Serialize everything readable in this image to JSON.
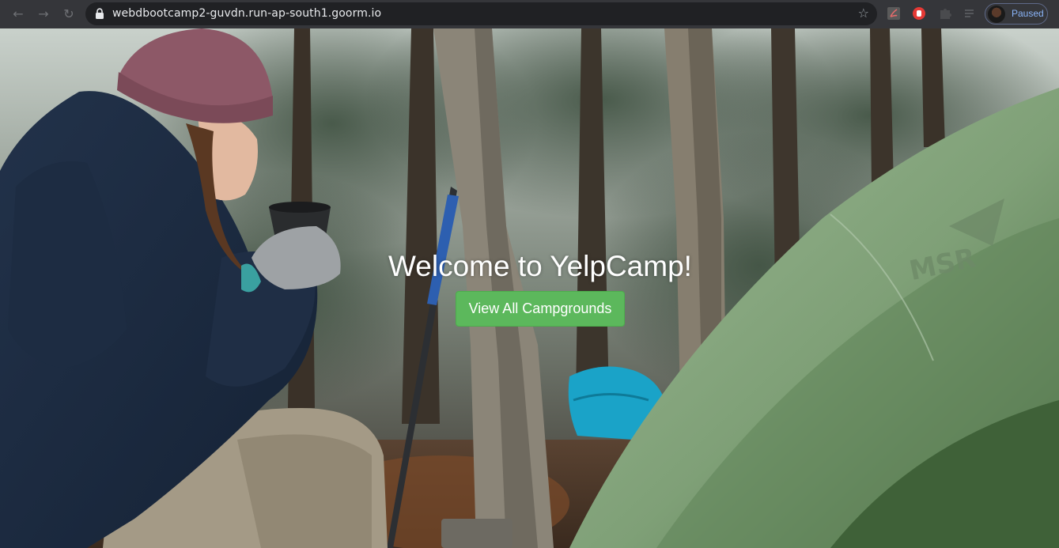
{
  "browser": {
    "back_icon": "arrow-left-icon",
    "forward_icon": "arrow-right-icon",
    "reload_icon": "reload-icon",
    "url": "webdbootcamp2-guvdn.run-ap-south1.goorm.io",
    "bookmark_icon": "star-icon",
    "extensions": [
      "pdf-icon",
      "hand-stop-icon",
      "puzzle-icon",
      "reading-list-icon"
    ],
    "profile": {
      "status": "Paused"
    }
  },
  "hero": {
    "title": "Welcome to YelpCamp!",
    "button_label": "View All Campgrounds",
    "button_color": "#5cb85c",
    "background_image": "forest-camping-photo"
  }
}
